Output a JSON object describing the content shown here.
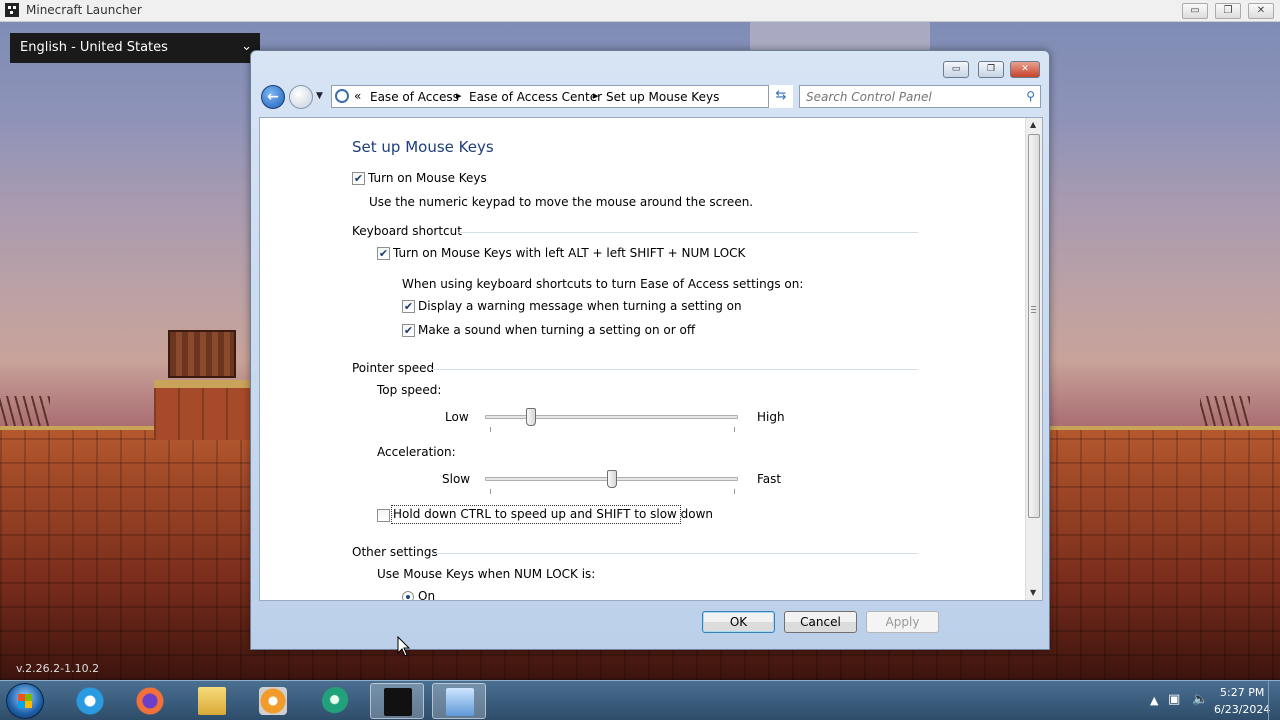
{
  "launcher": {
    "title": "Minecraft Launcher",
    "language": "English - United States",
    "version": "v.2.26.2-1.10.2",
    "controls": [
      "▭",
      "❐",
      "✕"
    ]
  },
  "window": {
    "controls": [
      "▭",
      "❐",
      "✕"
    ],
    "breadcrumbs": [
      "Ease of Access",
      "Ease of Access Center",
      "Set up Mouse Keys"
    ],
    "breadcrumb_prefix": "«",
    "search_placeholder": "Search Control Panel"
  },
  "page": {
    "title": "Set up Mouse Keys",
    "turn_on_mouse_keys": {
      "label": "Turn on Mouse Keys",
      "checked": true
    },
    "turn_on_description": "Use the numeric keypad to move the mouse around the screen.",
    "keyboard_shortcut": {
      "section": "Keyboard shortcut",
      "shortcut_option": {
        "label": "Turn on Mouse Keys with left ALT + left SHIFT + NUM LOCK",
        "checked": true
      },
      "sub_heading": "When using keyboard shortcuts to turn Ease of Access settings on:",
      "warning_option": {
        "label": "Display a warning message when turning a setting on",
        "checked": true
      },
      "sound_option": {
        "label": "Make a sound when turning a setting on or off",
        "checked": true
      }
    },
    "pointer_speed": {
      "section": "Pointer speed",
      "top_speed_label": "Top speed:",
      "top_speed_low": "Low",
      "top_speed_high": "High",
      "top_speed_value": 0.18,
      "acceleration_label": "Acceleration:",
      "accel_slow": "Slow",
      "accel_fast": "Fast",
      "acceleration_value": 0.5,
      "ctrl_shift_option": {
        "label": "Hold down CTRL to speed up and SHIFT to slow down",
        "checked": false
      }
    },
    "other_settings": {
      "section": "Other settings",
      "numlock_label": "Use Mouse Keys when NUM LOCK is:",
      "numlock_on": "On"
    }
  },
  "buttons": {
    "ok": "OK",
    "cancel": "Cancel",
    "apply": "Apply"
  },
  "taskbar": {
    "time": "5:27 PM",
    "date": "6/23/2024",
    "apps": [
      "internet-explorer-icon",
      "firefox-icon",
      "file-explorer-icon",
      "media-player-icon",
      "app-icon",
      "minecraft-icon",
      "control-panel-icon"
    ]
  }
}
